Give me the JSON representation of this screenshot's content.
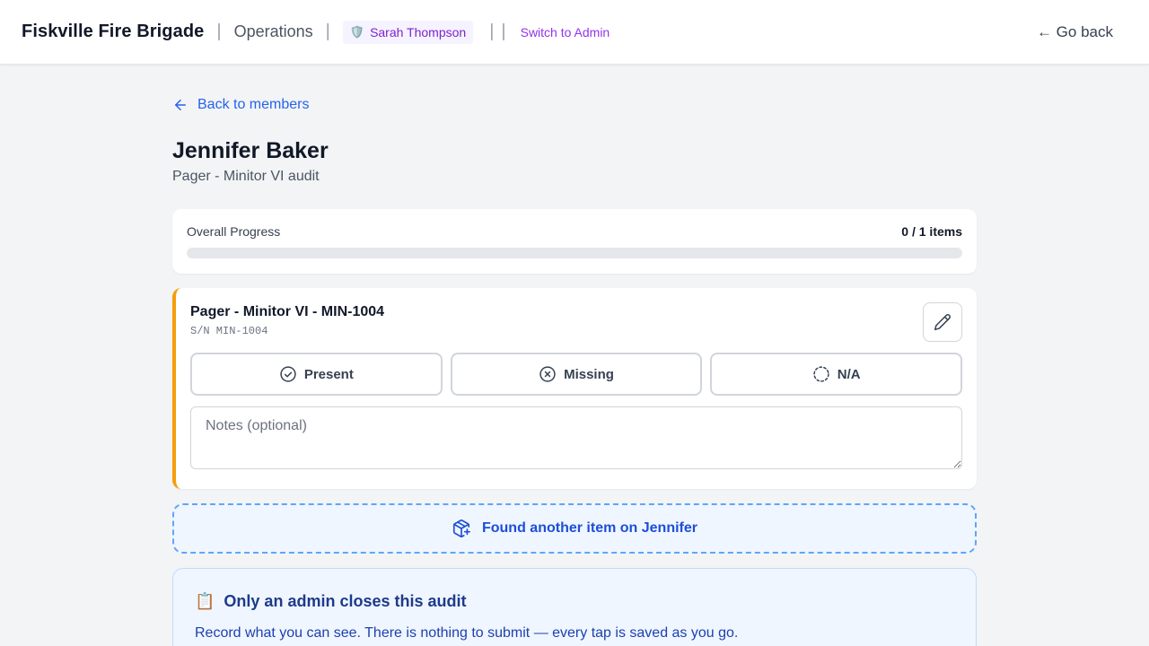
{
  "header": {
    "brand": "Fiskville Fire Brigade",
    "section": "Operations",
    "user_name": "Sarah Thompson",
    "user_icon": "shield-icon",
    "switch_label": "Switch to Admin",
    "go_back_label": "← Go back"
  },
  "nav": {
    "back_label": "Back to members"
  },
  "member": {
    "name": "Jennifer Baker",
    "audit": "Pager - Minitor VI audit"
  },
  "progress": {
    "label": "Overall Progress",
    "count_text": "0 / 1 items",
    "completed": 0,
    "total": 1
  },
  "item": {
    "title": "Pager - Minitor VI - MIN-1004",
    "serial": "S/N MIN-1004",
    "status_options": [
      "Present",
      "Missing",
      "N/A"
    ],
    "notes_placeholder": "Notes (optional)",
    "accent_color": "#f59e0b"
  },
  "found_label": "Found another item on Jennifer",
  "info": {
    "emoji": "📋",
    "title": "Only an admin closes this audit",
    "body": "Record what you can see. There is nothing to submit — every tap is saved as you go."
  },
  "colors": {
    "link": "#2563eb",
    "admin_purple": "#9333ea",
    "card_accent": "#f59e0b"
  }
}
